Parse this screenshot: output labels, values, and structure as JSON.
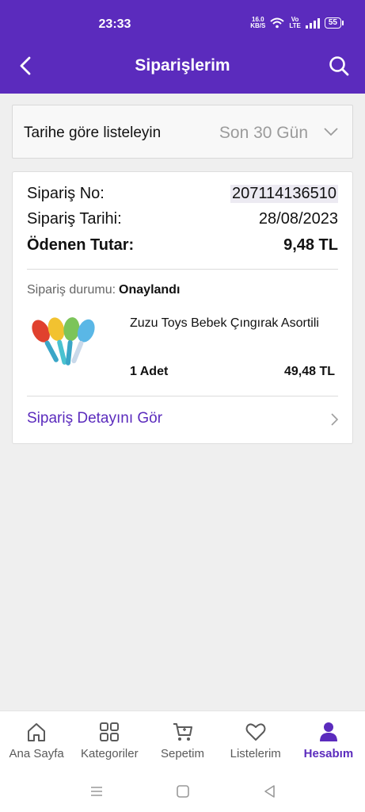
{
  "status_bar": {
    "time": "23:33",
    "net_speed_top": "16.0",
    "net_speed_bottom": "KB/S",
    "lte_top": "Vo",
    "lte_bottom": "LTE",
    "battery": "55"
  },
  "header": {
    "title": "Siparişlerim",
    "back_icon": "chevron-left-icon",
    "search_icon": "search-icon"
  },
  "filter": {
    "label": "Tarihe göre listeleyin",
    "value": "Son 30 Gün"
  },
  "order": {
    "no_label": "Sipariş No:",
    "no_value": "207114136510",
    "date_label": "Sipariş Tarihi:",
    "date_value": "28/08/2023",
    "paid_label": "Ödenen Tutar:",
    "paid_value": "9,48 TL",
    "status_label": "Sipariş durumu:",
    "status_value": "Onaylandı",
    "product_name": "Zuzu Toys Bebek Çıngırak Asortili",
    "quantity": "1 Adet",
    "price": "49,48 TL",
    "detail_link": "Sipariş Detayını Gör"
  },
  "bottom_nav": [
    {
      "label": "Ana Sayfa",
      "icon": "home-icon"
    },
    {
      "label": "Kategoriler",
      "icon": "grid-icon"
    },
    {
      "label": "Sepetim",
      "icon": "cart-icon"
    },
    {
      "label": "Listelerim",
      "icon": "heart-icon"
    },
    {
      "label": "Hesabım",
      "icon": "user-icon",
      "active": true
    }
  ],
  "colors": {
    "brand": "#5b2bbd",
    "background": "#efefef"
  }
}
